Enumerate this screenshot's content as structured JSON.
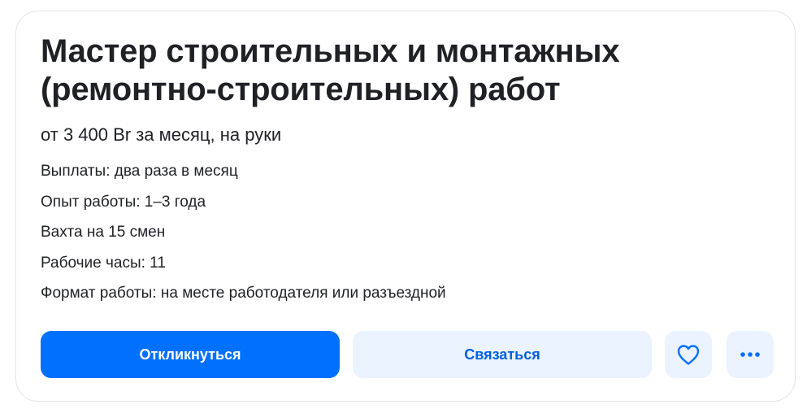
{
  "vacancy": {
    "title": "Мастер строительных и монтажных (ремонтно-строительных) работ",
    "salary": "от 3 400 Br за месяц, на руки",
    "facts": [
      "Выплаты: два раза в месяц",
      "Опыт работы: 1–3 года",
      "Вахта на 15 смен",
      "Рабочие часы: 11",
      "Формат работы: на месте работодателя или разъездной"
    ]
  },
  "actions": {
    "respond_label": "Откликнуться",
    "contact_label": "Связаться",
    "favorite_icon": "heart-icon",
    "more_icon": "more-horizontal-icon"
  },
  "colors": {
    "primary": "#0070ff",
    "secondary_bg": "#eaf3ff",
    "secondary_text": "#0060df",
    "text": "#1f2125"
  }
}
